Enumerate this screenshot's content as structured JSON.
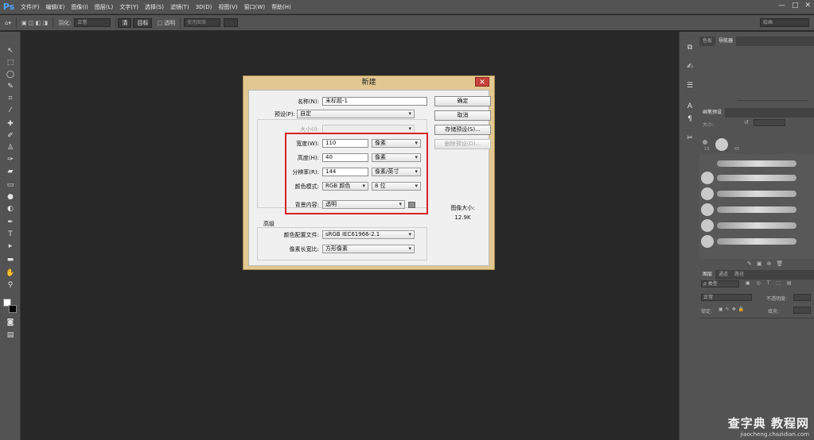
{
  "app": {
    "logo": "Ps"
  },
  "menu": [
    "文件(F)",
    "编辑(E)",
    "图像(I)",
    "图层(L)",
    "文字(Y)",
    "选择(S)",
    "滤镜(T)",
    "3D(D)",
    "视图(V)",
    "窗口(W)",
    "帮助(H)"
  ],
  "window_controls": [
    "—",
    "□",
    "✕"
  ],
  "options_bar": {
    "feather_label": "羽化:",
    "mode_value": "正常",
    "btn1": "清",
    "btn2": "目标",
    "transparent_label": "透明",
    "use_pattern": "使用图案",
    "workspace": "绘画"
  },
  "panels": {
    "top_tabs": [
      "色板",
      "导航器"
    ],
    "brush_tabs": [
      "画笔预设"
    ],
    "brush_size_label": "大小:",
    "brush_sizes": [
      "13",
      "65"
    ],
    "layers_tabs": [
      "图层",
      "通道",
      "路径"
    ],
    "layers_kind": "ρ 类型",
    "blend_mode": "正常",
    "opacity_label": "不透明度:",
    "lock_label": "锁定:",
    "fill_label": "填充:"
  },
  "dialog": {
    "title": "新建",
    "name_label": "名称(N):",
    "name_value": "未标题-1",
    "preset_label": "预设(P):",
    "preset_value": "自定",
    "size_label": "大小(I):",
    "width_label": "宽度(W):",
    "width_value": "110",
    "width_unit": "像素",
    "height_label": "高度(H):",
    "height_value": "40",
    "height_unit": "像素",
    "resolution_label": "分辨率(R):",
    "resolution_value": "144",
    "resolution_unit": "像素/英寸",
    "color_mode_label": "颜色模式:",
    "color_mode_value": "RGB 颜色",
    "bit_depth": "8 位",
    "bg_label": "背景内容:",
    "bg_value": "透明",
    "advanced_label": "高级",
    "color_profile_label": "颜色配置文件:",
    "color_profile_value": "sRGB IEC61966-2.1",
    "pixel_aspect_label": "像素长宽比:",
    "pixel_aspect_value": "方形像素",
    "ok_button": "确定",
    "cancel_button": "取消",
    "save_preset_button": "存储预设(S)...",
    "delete_preset_button": "删除预设(D)...",
    "image_size_label": "图像大小:",
    "image_size_value": "12.9K",
    "highlight_color": "#d6202a"
  },
  "watermark": {
    "main": "查字典 教程网",
    "url": "jiaocheng.chazidian.com"
  }
}
